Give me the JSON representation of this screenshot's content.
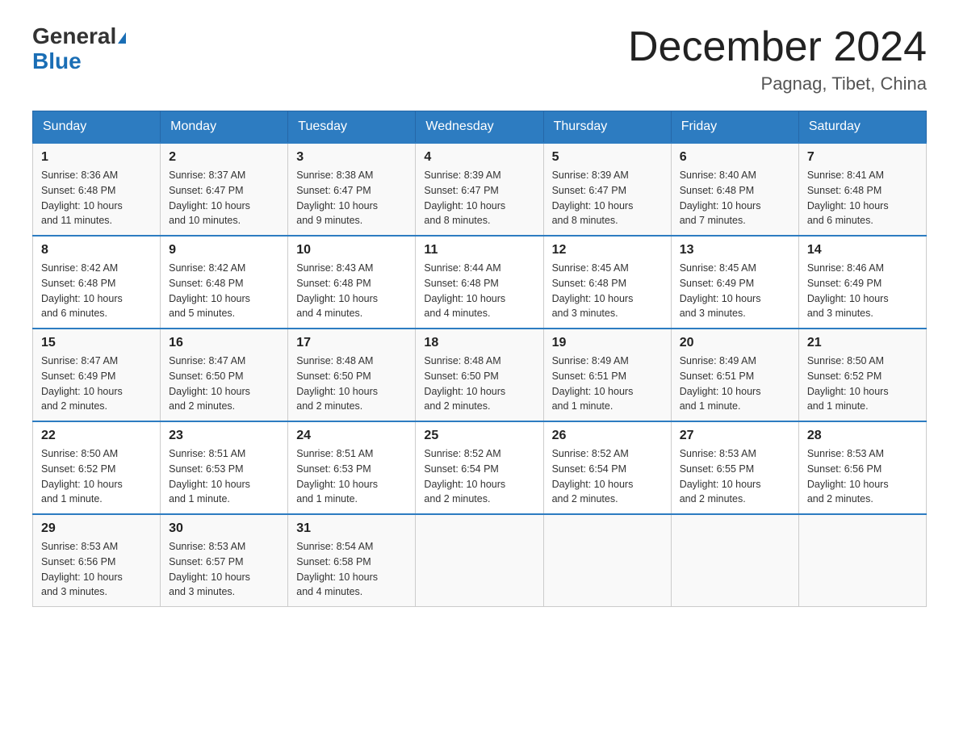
{
  "header": {
    "logo_general": "General",
    "logo_blue": "Blue",
    "month_title": "December 2024",
    "location": "Pagnag, Tibet, China"
  },
  "days_of_week": [
    "Sunday",
    "Monday",
    "Tuesday",
    "Wednesday",
    "Thursday",
    "Friday",
    "Saturday"
  ],
  "weeks": [
    [
      {
        "day": "1",
        "sunrise": "8:36 AM",
        "sunset": "6:48 PM",
        "daylight": "10 hours and 11 minutes."
      },
      {
        "day": "2",
        "sunrise": "8:37 AM",
        "sunset": "6:47 PM",
        "daylight": "10 hours and 10 minutes."
      },
      {
        "day": "3",
        "sunrise": "8:38 AM",
        "sunset": "6:47 PM",
        "daylight": "10 hours and 9 minutes."
      },
      {
        "day": "4",
        "sunrise": "8:39 AM",
        "sunset": "6:47 PM",
        "daylight": "10 hours and 8 minutes."
      },
      {
        "day": "5",
        "sunrise": "8:39 AM",
        "sunset": "6:47 PM",
        "daylight": "10 hours and 8 minutes."
      },
      {
        "day": "6",
        "sunrise": "8:40 AM",
        "sunset": "6:48 PM",
        "daylight": "10 hours and 7 minutes."
      },
      {
        "day": "7",
        "sunrise": "8:41 AM",
        "sunset": "6:48 PM",
        "daylight": "10 hours and 6 minutes."
      }
    ],
    [
      {
        "day": "8",
        "sunrise": "8:42 AM",
        "sunset": "6:48 PM",
        "daylight": "10 hours and 6 minutes."
      },
      {
        "day": "9",
        "sunrise": "8:42 AM",
        "sunset": "6:48 PM",
        "daylight": "10 hours and 5 minutes."
      },
      {
        "day": "10",
        "sunrise": "8:43 AM",
        "sunset": "6:48 PM",
        "daylight": "10 hours and 4 minutes."
      },
      {
        "day": "11",
        "sunrise": "8:44 AM",
        "sunset": "6:48 PM",
        "daylight": "10 hours and 4 minutes."
      },
      {
        "day": "12",
        "sunrise": "8:45 AM",
        "sunset": "6:48 PM",
        "daylight": "10 hours and 3 minutes."
      },
      {
        "day": "13",
        "sunrise": "8:45 AM",
        "sunset": "6:49 PM",
        "daylight": "10 hours and 3 minutes."
      },
      {
        "day": "14",
        "sunrise": "8:46 AM",
        "sunset": "6:49 PM",
        "daylight": "10 hours and 3 minutes."
      }
    ],
    [
      {
        "day": "15",
        "sunrise": "8:47 AM",
        "sunset": "6:49 PM",
        "daylight": "10 hours and 2 minutes."
      },
      {
        "day": "16",
        "sunrise": "8:47 AM",
        "sunset": "6:50 PM",
        "daylight": "10 hours and 2 minutes."
      },
      {
        "day": "17",
        "sunrise": "8:48 AM",
        "sunset": "6:50 PM",
        "daylight": "10 hours and 2 minutes."
      },
      {
        "day": "18",
        "sunrise": "8:48 AM",
        "sunset": "6:50 PM",
        "daylight": "10 hours and 2 minutes."
      },
      {
        "day": "19",
        "sunrise": "8:49 AM",
        "sunset": "6:51 PM",
        "daylight": "10 hours and 1 minute."
      },
      {
        "day": "20",
        "sunrise": "8:49 AM",
        "sunset": "6:51 PM",
        "daylight": "10 hours and 1 minute."
      },
      {
        "day": "21",
        "sunrise": "8:50 AM",
        "sunset": "6:52 PM",
        "daylight": "10 hours and 1 minute."
      }
    ],
    [
      {
        "day": "22",
        "sunrise": "8:50 AM",
        "sunset": "6:52 PM",
        "daylight": "10 hours and 1 minute."
      },
      {
        "day": "23",
        "sunrise": "8:51 AM",
        "sunset": "6:53 PM",
        "daylight": "10 hours and 1 minute."
      },
      {
        "day": "24",
        "sunrise": "8:51 AM",
        "sunset": "6:53 PM",
        "daylight": "10 hours and 1 minute."
      },
      {
        "day": "25",
        "sunrise": "8:52 AM",
        "sunset": "6:54 PM",
        "daylight": "10 hours and 2 minutes."
      },
      {
        "day": "26",
        "sunrise": "8:52 AM",
        "sunset": "6:54 PM",
        "daylight": "10 hours and 2 minutes."
      },
      {
        "day": "27",
        "sunrise": "8:53 AM",
        "sunset": "6:55 PM",
        "daylight": "10 hours and 2 minutes."
      },
      {
        "day": "28",
        "sunrise": "8:53 AM",
        "sunset": "6:56 PM",
        "daylight": "10 hours and 2 minutes."
      }
    ],
    [
      {
        "day": "29",
        "sunrise": "8:53 AM",
        "sunset": "6:56 PM",
        "daylight": "10 hours and 3 minutes."
      },
      {
        "day": "30",
        "sunrise": "8:53 AM",
        "sunset": "6:57 PM",
        "daylight": "10 hours and 3 minutes."
      },
      {
        "day": "31",
        "sunrise": "8:54 AM",
        "sunset": "6:58 PM",
        "daylight": "10 hours and 4 minutes."
      },
      null,
      null,
      null,
      null
    ]
  ],
  "labels": {
    "sunrise": "Sunrise:",
    "sunset": "Sunset:",
    "daylight": "Daylight:"
  }
}
